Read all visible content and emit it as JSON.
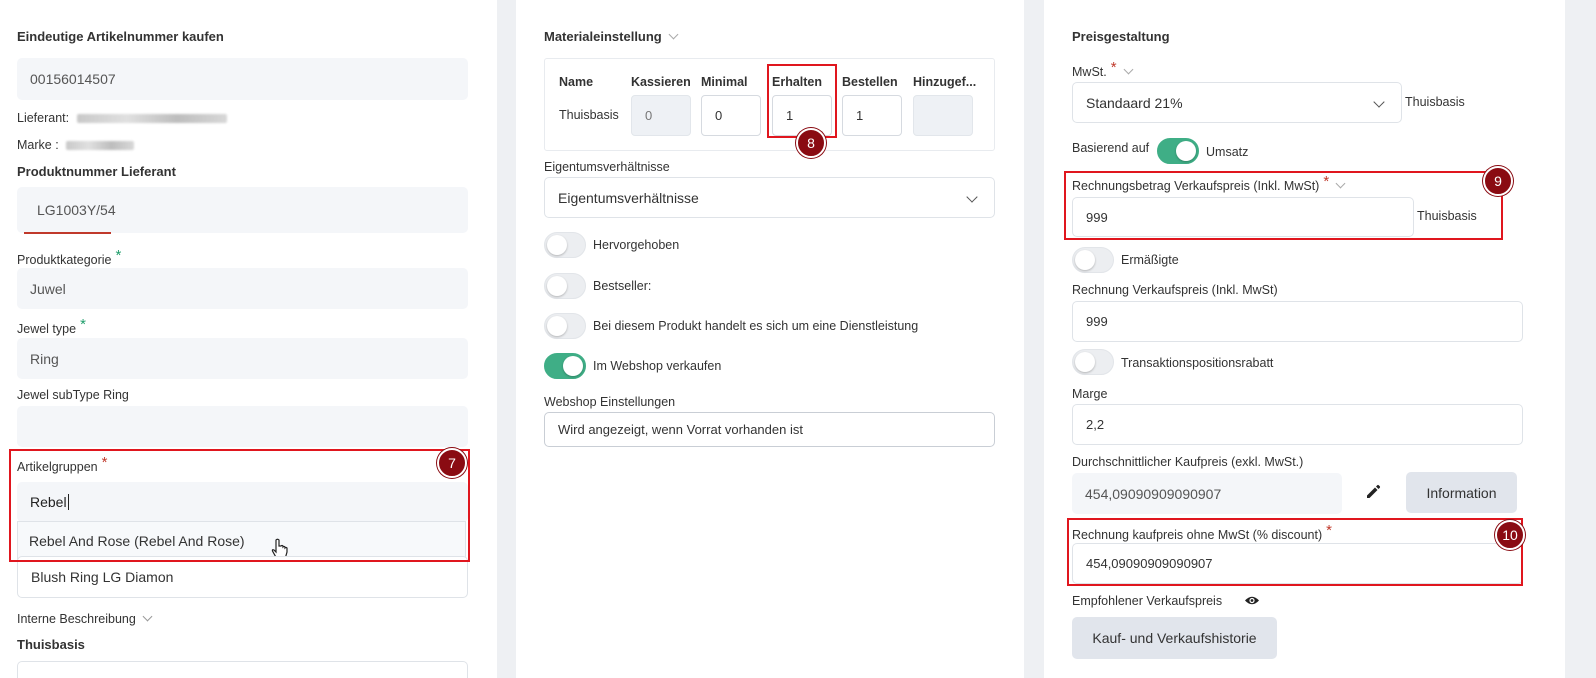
{
  "left": {
    "title": "Eindeutige Artikelnummer kaufen",
    "article_number": "00156014507",
    "supplier_label": "Lieferant:",
    "brand_label": "Marke :",
    "supplier_number_title": "Produktnummer Lieferant",
    "supplier_number": "LG1003Y/54",
    "category_label": "Produktkategorie",
    "category_value": "Juwel",
    "jewel_type_label": "Jewel type",
    "jewel_type_value": "Ring",
    "jewel_subtype_label": "Jewel subType Ring",
    "jewel_subtype_value": "",
    "article_groups_label": "Artikelgruppen",
    "article_groups_input": "Rebel",
    "article_groups_suggestion": "Rebel And Rose (Rebel And Rose)",
    "description_value": "Blush Ring LG Diamon",
    "internal_desc_label": "Interne Beschreibung",
    "location_title": "Thuisbasis",
    "badge": "7"
  },
  "material": {
    "title": "Materialeinstellung",
    "headers": [
      "Name",
      "Kassieren",
      "Minimal",
      "Erhalten",
      "Bestellen",
      "Hinzugef..."
    ],
    "row_name": "Thuisbasis",
    "kassieren": "0",
    "minimal": "0",
    "erhalten": "1",
    "bestellen": "1",
    "hinzugefuegt": "",
    "badge": "8",
    "ownership_label": "Eigentumsverhältnisse",
    "ownership_value": "Eigentumsverhältnisse",
    "toggles": [
      {
        "label": "Hervorgehoben",
        "on": false
      },
      {
        "label": "Bestseller:",
        "on": false
      },
      {
        "label": "Bei diesem Produkt handelt es sich um eine Dienstleistung",
        "on": false
      },
      {
        "label": "Im Webshop verkaufen",
        "on": true
      }
    ],
    "webshop_label": "Webshop Einstellungen",
    "webshop_value": "Wird angezeigt, wenn Vorrat vorhanden ist"
  },
  "pricing": {
    "title": "Preisgestaltung",
    "vat_label": "MwSt.",
    "vat_value": "Standaard 21%",
    "vat_location": "Thuisbasis",
    "based_on_label": "Basierend auf",
    "based_on_value": "Umsatz",
    "invoice_sale_label": "Rechnungsbetrag Verkaufspreis (Inkl. MwSt)",
    "invoice_sale_value": "999",
    "invoice_sale_location": "Thuisbasis",
    "badge9": "9",
    "reduced_label": "Ermäßigte",
    "sale_price_label": "Rechnung Verkaufspreis (Inkl. MwSt)",
    "sale_price_value": "999",
    "transaction_discount_label": "Transaktionspositionsrabatt",
    "margin_label": "Marge",
    "margin_value": "2,2",
    "avg_purchase_label": "Durchschnittlicher Kaufpreis (exkl. MwSt.)",
    "avg_purchase_value": "454,09090909090907",
    "info_button": "Information",
    "purchase_no_vat_label": "Rechnung kaufpreis ohne MwSt (% discount)",
    "purchase_no_vat_value": "454,09090909090907",
    "badge10": "10",
    "recommended_label": "Empfohlener Verkaufspreis",
    "history_button": "Kauf- und Verkaufshistorie"
  },
  "colors": {
    "accent_red": "#e0161e",
    "badge": "#8a0b12",
    "toggle_on": "#3fae86",
    "required_green": "#1f9d6b"
  }
}
